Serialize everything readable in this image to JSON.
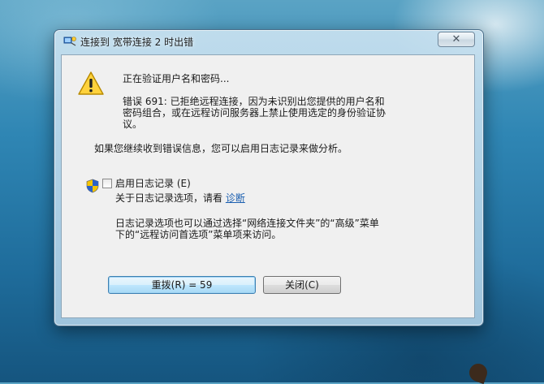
{
  "window": {
    "title": "连接到 宽带连接 2 时出错",
    "close_glyph": "✕"
  },
  "dialog": {
    "status": "正在验证用户名和密码...",
    "error_line1": "错误 691: 已拒绝远程连接，因为未识别出您提供的用户名和",
    "error_line2": "密码组合，或在远程访问服务器上禁止使用选定的身份验证协",
    "error_line3": "议。",
    "continue_text": "如果您继续收到错误信息，您可以启用日志记录来做分析。",
    "logging_checkbox_label": "启用日志记录 (E)",
    "logging_checked": false,
    "options_text": "关于日志记录选项，请看 ",
    "diagnose_link": "诊断",
    "info_line1": "日志记录选项也可以通过选择“网络连接文件夹”的“高级”菜单",
    "info_line2": "下的“远程访问首选项”菜单项来访问。"
  },
  "buttons": {
    "redial": "重拨(R) = 59",
    "close": "关闭(C)"
  },
  "icons": {
    "title": "network-connection-icon",
    "warning": "warning-icon",
    "shield": "uac-shield-icon"
  }
}
